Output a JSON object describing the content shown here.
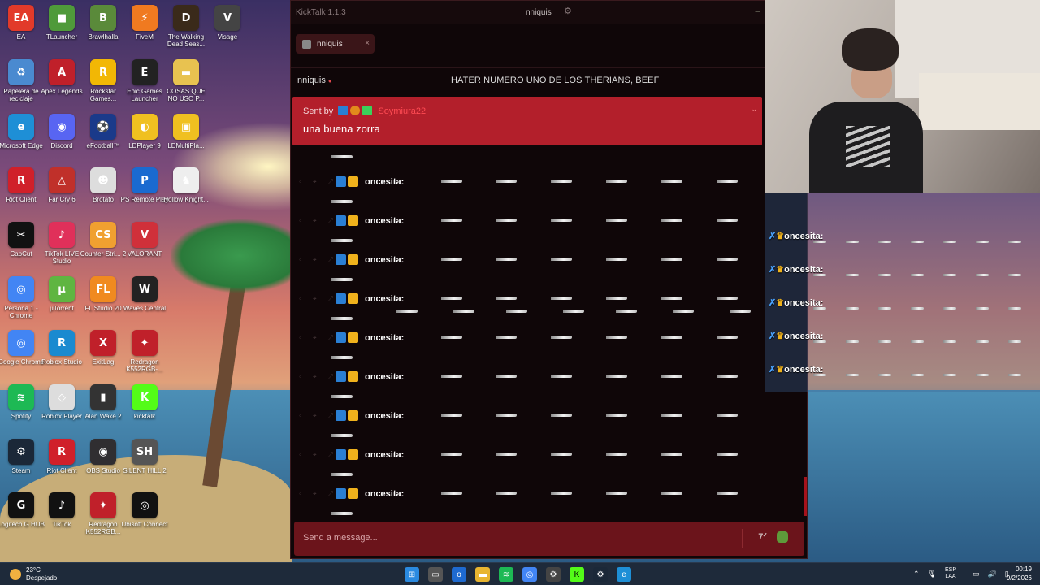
{
  "desktop_icons": [
    {
      "label": "EA",
      "color": "#e23a2a",
      "glyph": "EA"
    },
    {
      "label": "TLauncher",
      "color": "#4f9a3a",
      "glyph": "■"
    },
    {
      "label": "Brawlhalla",
      "color": "#5a8a3a",
      "glyph": "B"
    },
    {
      "label": "FiveM",
      "color": "#f07a20",
      "glyph": "⚡"
    },
    {
      "label": "The Walking Dead Seas...",
      "color": "#3a2a1a",
      "glyph": "D"
    },
    {
      "label": "Visage",
      "color": "#444",
      "glyph": "V"
    },
    {
      "label": "Papelera de reciclaje",
      "color": "#4a8ad0",
      "glyph": "♻"
    },
    {
      "label": "Apex Legends",
      "color": "#c0202a",
      "glyph": "A"
    },
    {
      "label": "Rockstar Games...",
      "color": "#f2b705",
      "glyph": "R"
    },
    {
      "label": "Epic Games Launcher",
      "color": "#222",
      "glyph": "E"
    },
    {
      "label": "COSAS QUE NO USO P...",
      "color": "#e8c250",
      "glyph": "▬"
    },
    {
      "label": "Microsoft Edge",
      "color": "#1e8fd6",
      "glyph": "e"
    },
    {
      "label": "Discord",
      "color": "#5865f2",
      "glyph": "◉"
    },
    {
      "label": "eFootball™",
      "color": "#1a3a8a",
      "glyph": "⚽"
    },
    {
      "label": "LDPlayer 9",
      "color": "#f0c020",
      "glyph": "◐"
    },
    {
      "label": "LDMultiPla...",
      "color": "#f0c020",
      "glyph": "▣"
    },
    {
      "label": "Riot Client",
      "color": "#d0202a",
      "glyph": "R"
    },
    {
      "label": "Far Cry 6",
      "color": "#c0302a",
      "glyph": "△"
    },
    {
      "label": "Brotato",
      "color": "#ddd",
      "glyph": "☻"
    },
    {
      "label": "PS Remote Play",
      "color": "#1a6ad0",
      "glyph": "P"
    },
    {
      "label": "Hollow Knight...",
      "color": "#eee",
      "glyph": "♞"
    },
    {
      "label": "CapCut",
      "color": "#111",
      "glyph": "✂"
    },
    {
      "label": "TikTok LIVE Studio",
      "color": "#e0305a",
      "glyph": "♪"
    },
    {
      "label": "Counter-Stri... 2",
      "color": "#f0a030",
      "glyph": "CS"
    },
    {
      "label": "VALORANT",
      "color": "#d0303a",
      "glyph": "V"
    },
    {
      "label": "Persona 1 - Chrome",
      "color": "#4285f4",
      "glyph": "◎"
    },
    {
      "label": "µTorrent",
      "color": "#5fb541",
      "glyph": "µ"
    },
    {
      "label": "FL Studio 20",
      "color": "#f08a20",
      "glyph": "FL"
    },
    {
      "label": "Waves Central",
      "color": "#222",
      "glyph": "W"
    },
    {
      "label": "Google Chrome",
      "color": "#4285f4",
      "glyph": "◎"
    },
    {
      "label": "Roblox Studio",
      "color": "#1a8ad0",
      "glyph": "R"
    },
    {
      "label": "ExitLag",
      "color": "#c0202a",
      "glyph": "X"
    },
    {
      "label": "Redragon K552RGB-...",
      "color": "#c0202a",
      "glyph": "✦"
    },
    {
      "label": "Spotify",
      "color": "#1db954",
      "glyph": "≋"
    },
    {
      "label": "Roblox Player",
      "color": "#ddd",
      "glyph": "◇"
    },
    {
      "label": "Alan Wake 2",
      "color": "#333",
      "glyph": "▮"
    },
    {
      "label": "kicktalk",
      "color": "#53fc18",
      "glyph": "K"
    },
    {
      "label": "Steam",
      "color": "#1b2838",
      "glyph": "⚙"
    },
    {
      "label": "Riot Client",
      "color": "#d0202a",
      "glyph": "R"
    },
    {
      "label": "OBS Studio",
      "color": "#302e31",
      "glyph": "◉"
    },
    {
      "label": "SILENT HILL 2",
      "color": "#555",
      "glyph": "SH"
    },
    {
      "label": "Logitech G HUB",
      "color": "#111",
      "glyph": "G"
    },
    {
      "label": "TikTok",
      "color": "#111",
      "glyph": "♪"
    },
    {
      "label": "Redragon K552RGB...",
      "color": "#c0202a",
      "glyph": "✦"
    },
    {
      "label": "Ubisoft Connect",
      "color": "#111",
      "glyph": "◎"
    }
  ],
  "kicktalk": {
    "app_title": "KickTalk 1.1.3",
    "titlebar_user": "nniquis",
    "tab_name": "nniquis",
    "channel_name": "nniquis",
    "stream_title": "HATER NUMERO UNO DE LOS THERIANS, BEEF",
    "pinned": {
      "sent_by_label": "Sent by",
      "sender": "Soymiura22",
      "message": "una buena zorra"
    },
    "chat_user": "oncesita:",
    "message_count": 9,
    "input_placeholder": "Send a message..."
  },
  "overlay": {
    "user": "oncesita:",
    "rows": 5
  },
  "taskbar": {
    "temperature": "23°C",
    "weather": "Despejado",
    "lang_top": "ESP",
    "lang_bottom": "LAA",
    "time": "00:19",
    "date": "9/2/2026"
  },
  "colors": {
    "kick_green": "#53fc18",
    "pin_red": "#b31f2b",
    "input_red": "#6b141b"
  }
}
